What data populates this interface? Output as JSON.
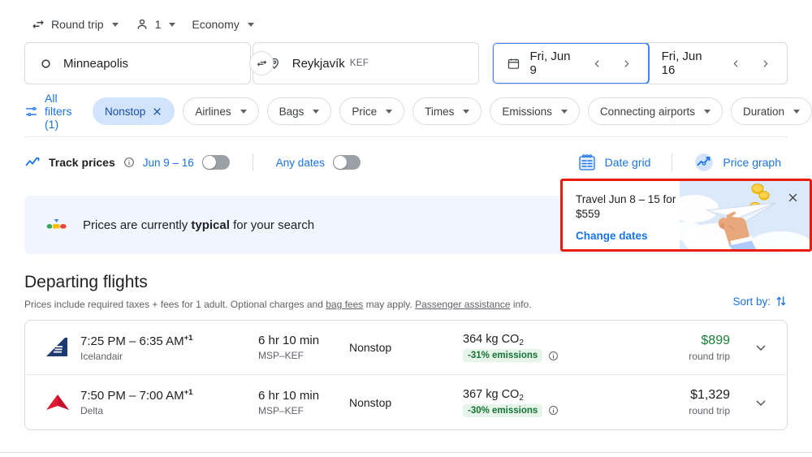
{
  "options": {
    "trip_type": "Round trip",
    "passengers": "1",
    "cabin_class": "Economy",
    "trip_icon": "swap-horizontal-icon",
    "passenger_icon": "person-icon"
  },
  "search": {
    "origin": "Minneapolis",
    "origin_icon": "circle-origin-icon",
    "destination": "Reykjavík",
    "destination_code": "KEF",
    "destination_icon": "map-pin-icon",
    "swap_icon": "swap-arrows-icon",
    "depart_date": "Fri, Jun 9",
    "return_date": "Fri, Jun 16",
    "calendar_icon": "calendar-icon",
    "prev_icon": "chevron-left-icon",
    "next_icon": "chevron-right-icon"
  },
  "filters": {
    "all_filters_label": "All filters (1)",
    "all_filters_icon": "tune-icon",
    "chips": [
      {
        "label": "Nonstop",
        "active": true,
        "remove_icon": "close-icon"
      },
      {
        "label": "Airlines",
        "active": false
      },
      {
        "label": "Bags",
        "active": false
      },
      {
        "label": "Price",
        "active": false
      },
      {
        "label": "Times",
        "active": false
      },
      {
        "label": "Emissions",
        "active": false
      },
      {
        "label": "Connecting airports",
        "active": false
      },
      {
        "label": "Duration",
        "active": false
      }
    ]
  },
  "track": {
    "label": "Track prices",
    "info_icon": "info-icon",
    "trend_icon": "trend-line-icon",
    "date_range": "Jun 9 – 16",
    "date_toggle_on": false,
    "any_dates_label": "Any dates",
    "any_dates_toggle_on": false,
    "date_grid_label": "Date grid",
    "date_grid_icon": "calendar-grid-icon",
    "price_graph_label": "Price graph",
    "price_graph_icon": "price-graph-icon"
  },
  "insights": {
    "text_before": "Prices are currently ",
    "text_bold": "typical",
    "text_after": " for your search",
    "icon": "price-gauge-icon",
    "background": "#f0f5ff"
  },
  "callout": {
    "line1": "Travel Jun 8 – 15 for",
    "line2": "$559",
    "link": "Change dates",
    "close_icon": "close-icon",
    "illustration": "hand-paper-plane-coins-illustration",
    "highlight_color": "#ea1b0c"
  },
  "departing": {
    "title": "Departing flights",
    "subtitle_1": "Prices include required taxes + fees for 1 adult. Optional charges and ",
    "subtitle_link_1": "bag fees",
    "subtitle_2": " may apply. ",
    "subtitle_link_2": "Passenger assistance",
    "subtitle_3": " info.",
    "sort_label": "Sort by:",
    "sort_icon": "sort-arrows-icon"
  },
  "flights": [
    {
      "airline": "Icelandair",
      "airline_logo": "icelandair-tail-logo",
      "logo_color": "#1d3a73",
      "times": "7:25 PM – 6:35 AM",
      "day_offset": "+1",
      "duration": "6 hr 10 min",
      "route": "MSP–KEF",
      "stops": "Nonstop",
      "emissions": "364 kg CO",
      "emissions_sub": "2",
      "emissions_badge": "-31% emissions",
      "emissions_info_icon": "info-icon",
      "price": "$899",
      "price_is_deal": true,
      "price_sub": "round trip",
      "expand_icon": "chevron-down-icon"
    },
    {
      "airline": "Delta",
      "airline_logo": "delta-widget-logo",
      "logo_color": "#c8102e",
      "times": "7:50 PM – 7:00 AM",
      "day_offset": "+1",
      "duration": "6 hr 10 min",
      "route": "MSP–KEF",
      "stops": "Nonstop",
      "emissions": "367 kg CO",
      "emissions_sub": "2",
      "emissions_badge": "-30% emissions",
      "emissions_info_icon": "info-icon",
      "price": "$1,329",
      "price_is_deal": false,
      "price_sub": "round trip",
      "expand_icon": "chevron-down-icon"
    }
  ],
  "colors": {
    "accent_blue": "#1a73e8",
    "deal_green": "#188038",
    "badge_green_bg": "#e6f4ea",
    "badge_green_fg": "#137333"
  }
}
